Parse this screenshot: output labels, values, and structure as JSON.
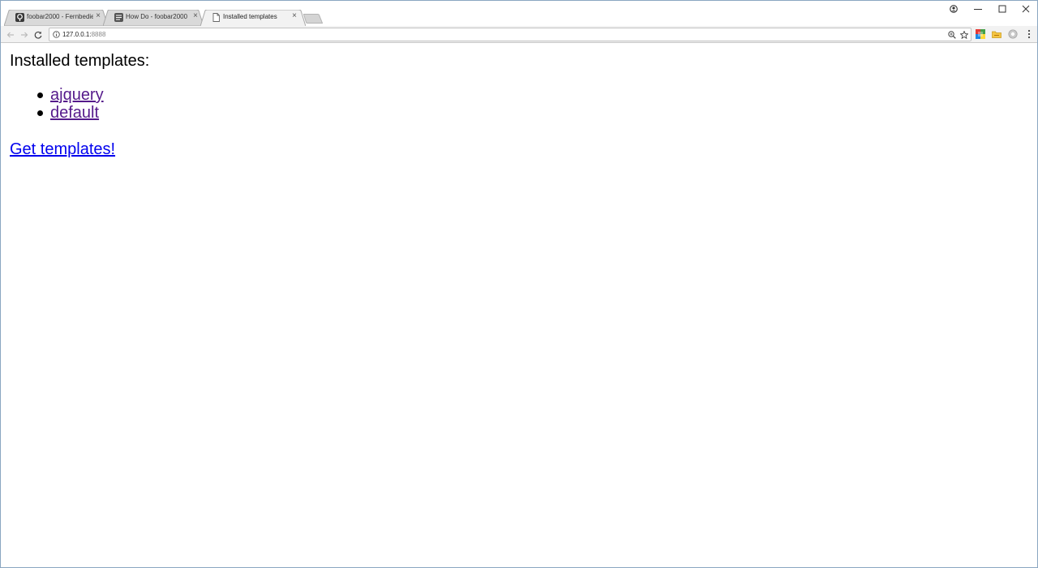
{
  "browser": {
    "tabs": [
      {
        "title": "foobar2000 - Fernbedien",
        "active": false
      },
      {
        "title": "How Do - foobar2000",
        "active": false
      },
      {
        "title": "Installed templates",
        "active": true
      }
    ],
    "address": {
      "host": "127.0.0.1:",
      "port": "8888"
    },
    "icons": {
      "profile": "profile-icon",
      "minimize": "minimize-icon",
      "maximize": "maximize-icon",
      "close": "close-icon"
    }
  },
  "page": {
    "heading": "Installed templates:",
    "templates": [
      {
        "label": "ajquery"
      },
      {
        "label": "default"
      }
    ],
    "get_templates_label": "Get templates!"
  },
  "colors": {
    "visited_link": "#551a8b",
    "link": "#0000ee"
  }
}
